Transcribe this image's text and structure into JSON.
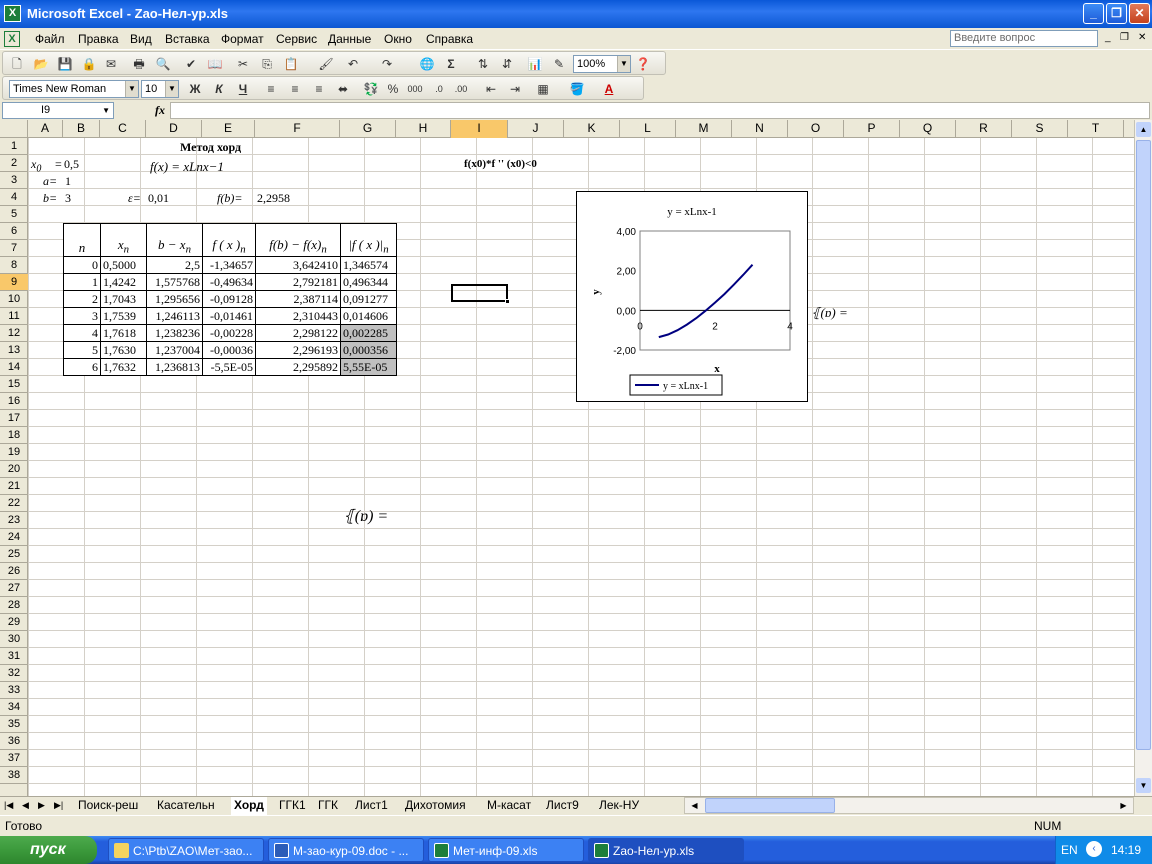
{
  "window": {
    "title": "Microsoft Excel - Zao-Нел-ур.xls"
  },
  "menu": {
    "items": [
      "Файл",
      "Правка",
      "Вид",
      "Вставка",
      "Формат",
      "Сервис",
      "Данные",
      "Окно",
      "Справка"
    ],
    "help_placeholder": "Введите вопрос"
  },
  "toolbar": {
    "zoom": "100%",
    "font": "Times New Roman",
    "size": "10",
    "bold": "Ж",
    "italic": "К",
    "underline": "Ч",
    "percent": "%",
    "thousands": "000"
  },
  "formula": {
    "namebox": "I9",
    "fx": "fx",
    "content": ""
  },
  "columns": [
    "A",
    "B",
    "C",
    "D",
    "E",
    "F",
    "G",
    "H",
    "I",
    "J",
    "K",
    "L",
    "M",
    "N",
    "O",
    "P",
    "Q",
    "R",
    "S",
    "T"
  ],
  "rows": [
    "1",
    "2",
    "3",
    "4",
    "5",
    "6",
    "7",
    "8",
    "9",
    "10",
    "11",
    "12",
    "13",
    "14",
    "15",
    "16",
    "17",
    "18",
    "19",
    "20",
    "21",
    "22",
    "23",
    "24",
    "25",
    "26",
    "27",
    "28",
    "29",
    "30",
    "31",
    "32",
    "33",
    "34",
    "35",
    "36",
    "37",
    "38"
  ],
  "sheet": {
    "title": "Метод хорд",
    "x0_label": "x",
    "x0_sub": "0",
    "x0_eq": "=",
    "x0_val": "0,5",
    "fx_formula": "f(x) = xLnx−1",
    "a_label": "a=",
    "a_val": "1",
    "b_label": "b=",
    "b_val": "3",
    "eps_label": "ε=",
    "eps_val": "0,01",
    "fb_label": "f(b)=",
    "fb_val": "2,2958",
    "condition": "f(x0)*f '' (x0)<0",
    "stray1": "⦃(ɒ) =",
    "stray2": "⦃(ɒ) ="
  },
  "table": {
    "headers": [
      "n",
      "x",
      "b − x",
      "f ( x )",
      "f(b) − f(x)",
      "|f ( x )|"
    ],
    "header_subs": [
      "",
      "n",
      "n",
      "n",
      "n",
      "n"
    ],
    "rows": [
      [
        "0",
        "0,5000",
        "2,5",
        "-1,34657",
        "3,642410",
        "1,346574"
      ],
      [
        "1",
        "1,4242",
        "1,575768",
        "-0,49634",
        "2,792181",
        "0,496344"
      ],
      [
        "2",
        "1,7043",
        "1,295656",
        "-0,09128",
        "2,387114",
        "0,091277"
      ],
      [
        "3",
        "1,7539",
        "1,246113",
        "-0,01461",
        "2,310443",
        "0,014606"
      ],
      [
        "4",
        "1,7618",
        "1,238236",
        "-0,00228",
        "2,298122",
        "0,002285"
      ],
      [
        "5",
        "1,7630",
        "1,237004",
        "-0,00036",
        "2,296193",
        "0,000356"
      ],
      [
        "6",
        "1,7632",
        "1,236813",
        "-5,5E-05",
        "2,295892",
        "5,55E-05"
      ]
    ]
  },
  "chart_data": {
    "type": "line",
    "title": "y = xLnx-1",
    "xlabel": "x",
    "ylabel": "y",
    "xlim": [
      0,
      4
    ],
    "ylim": [
      -2,
      4
    ],
    "x_ticks": [
      "0",
      "2",
      "4"
    ],
    "y_ticks": [
      "4,00",
      "2,00",
      "0,00",
      "-2,00"
    ],
    "series": [
      {
        "name": "y = xLnx-1",
        "color": "#000080",
        "x": [
          0.5,
          0.75,
          1,
          1.25,
          1.5,
          1.75,
          2,
          2.25,
          2.5,
          2.75,
          3
        ],
        "y": [
          -1.35,
          -1.22,
          -1,
          -0.72,
          -0.39,
          -0.02,
          0.39,
          0.82,
          1.29,
          1.78,
          2.3
        ]
      }
    ],
    "legend": "bottom"
  },
  "tabs": [
    "Поиск-реш",
    "Касательн",
    "Хорд",
    "ГГК1",
    "ГГК",
    "Лист1",
    "Дихотомия",
    "М-касат",
    "Лист9",
    "Лек-НУ"
  ],
  "active_tab": "Хорд",
  "status": {
    "left": "Готово",
    "num": "NUM"
  },
  "taskbar": {
    "start": "пуск",
    "tasks": [
      "C:\\Ptb\\ZAO\\Мет-зао...",
      "М-зао-кур-09.doc - ...",
      "Мет-инф-09.xls",
      "Zao-Нел-ур.xls"
    ],
    "lang": "EN",
    "clock": "14:19"
  }
}
